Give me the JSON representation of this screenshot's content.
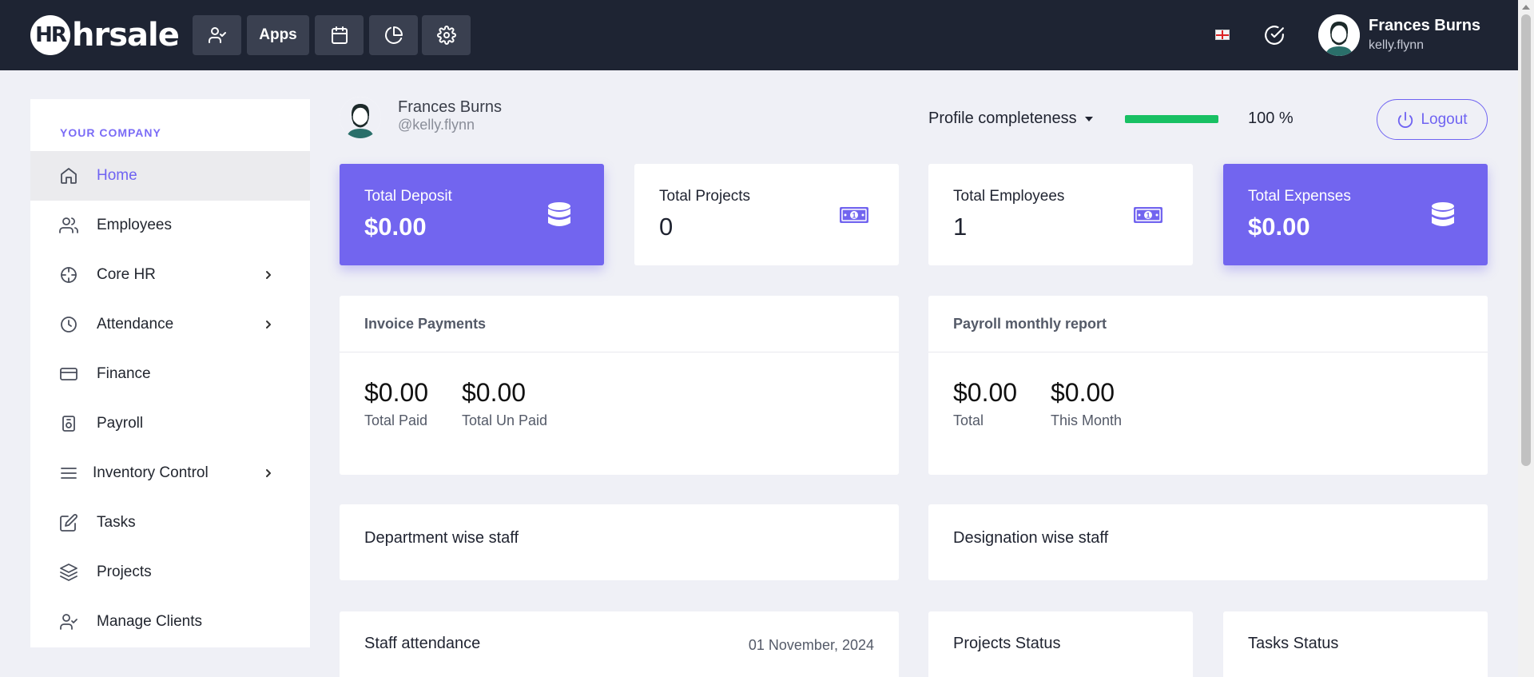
{
  "header": {
    "logo_mark": "HR",
    "logo_text": "hrsale",
    "apps_label": "Apps",
    "user_name": "Frances Burns",
    "user_handle": "kelly.flynn"
  },
  "sidebar": {
    "section_title": "YOUR COMPANY",
    "items": [
      {
        "label": "Home",
        "icon": "home-icon",
        "active": true,
        "has_submenu": false
      },
      {
        "label": "Employees",
        "icon": "users-icon",
        "active": false,
        "has_submenu": false
      },
      {
        "label": "Core HR",
        "icon": "crosshair-icon",
        "active": false,
        "has_submenu": true
      },
      {
        "label": "Attendance",
        "icon": "clock-icon",
        "active": false,
        "has_submenu": true
      },
      {
        "label": "Finance",
        "icon": "credit-card-icon",
        "active": false,
        "has_submenu": false
      },
      {
        "label": "Payroll",
        "icon": "payroll-icon",
        "active": false,
        "has_submenu": false
      },
      {
        "label": "Inventory Control",
        "icon": "menu-lines-icon",
        "active": false,
        "has_submenu": true
      },
      {
        "label": "Tasks",
        "icon": "edit-icon",
        "active": false,
        "has_submenu": false
      },
      {
        "label": "Projects",
        "icon": "layers-icon",
        "active": false,
        "has_submenu": false
      },
      {
        "label": "Manage Clients",
        "icon": "user-check-icon",
        "active": false,
        "has_submenu": false
      }
    ]
  },
  "profile": {
    "name": "Frances Burns",
    "handle": "@kelly.flynn",
    "completeness_label": "Profile completeness",
    "completeness_percent": 100,
    "completeness_text": "100 %",
    "logout_label": "Logout"
  },
  "stats": [
    {
      "title": "Total Deposit",
      "value": "$0.00",
      "icon": "database-icon",
      "style": "purple"
    },
    {
      "title": "Total Projects",
      "value": "0",
      "icon": "money-icon",
      "style": "white"
    },
    {
      "title": "Total Employees",
      "value": "1",
      "icon": "money-icon",
      "style": "white"
    },
    {
      "title": "Total Expenses",
      "value": "$0.00",
      "icon": "database-icon",
      "style": "purple"
    }
  ],
  "invoice": {
    "title": "Invoice Payments",
    "paid_value": "$0.00",
    "paid_label": "Total Paid",
    "unpaid_value": "$0.00",
    "unpaid_label": "Total Un Paid"
  },
  "payroll_report": {
    "title": "Payroll monthly report",
    "total_value": "$0.00",
    "total_label": "Total",
    "month_value": "$0.00",
    "month_label": "This Month"
  },
  "department_staff": {
    "title": "Department wise staff"
  },
  "designation_staff": {
    "title": "Designation wise staff"
  },
  "staff_attendance": {
    "title": "Staff attendance",
    "date": "01 November, 2024"
  },
  "projects_status": {
    "title": "Projects Status"
  },
  "tasks_status": {
    "title": "Tasks Status"
  },
  "colors": {
    "accent": "#7265ef",
    "topbar": "#1e2433",
    "progress": "#18c063"
  }
}
